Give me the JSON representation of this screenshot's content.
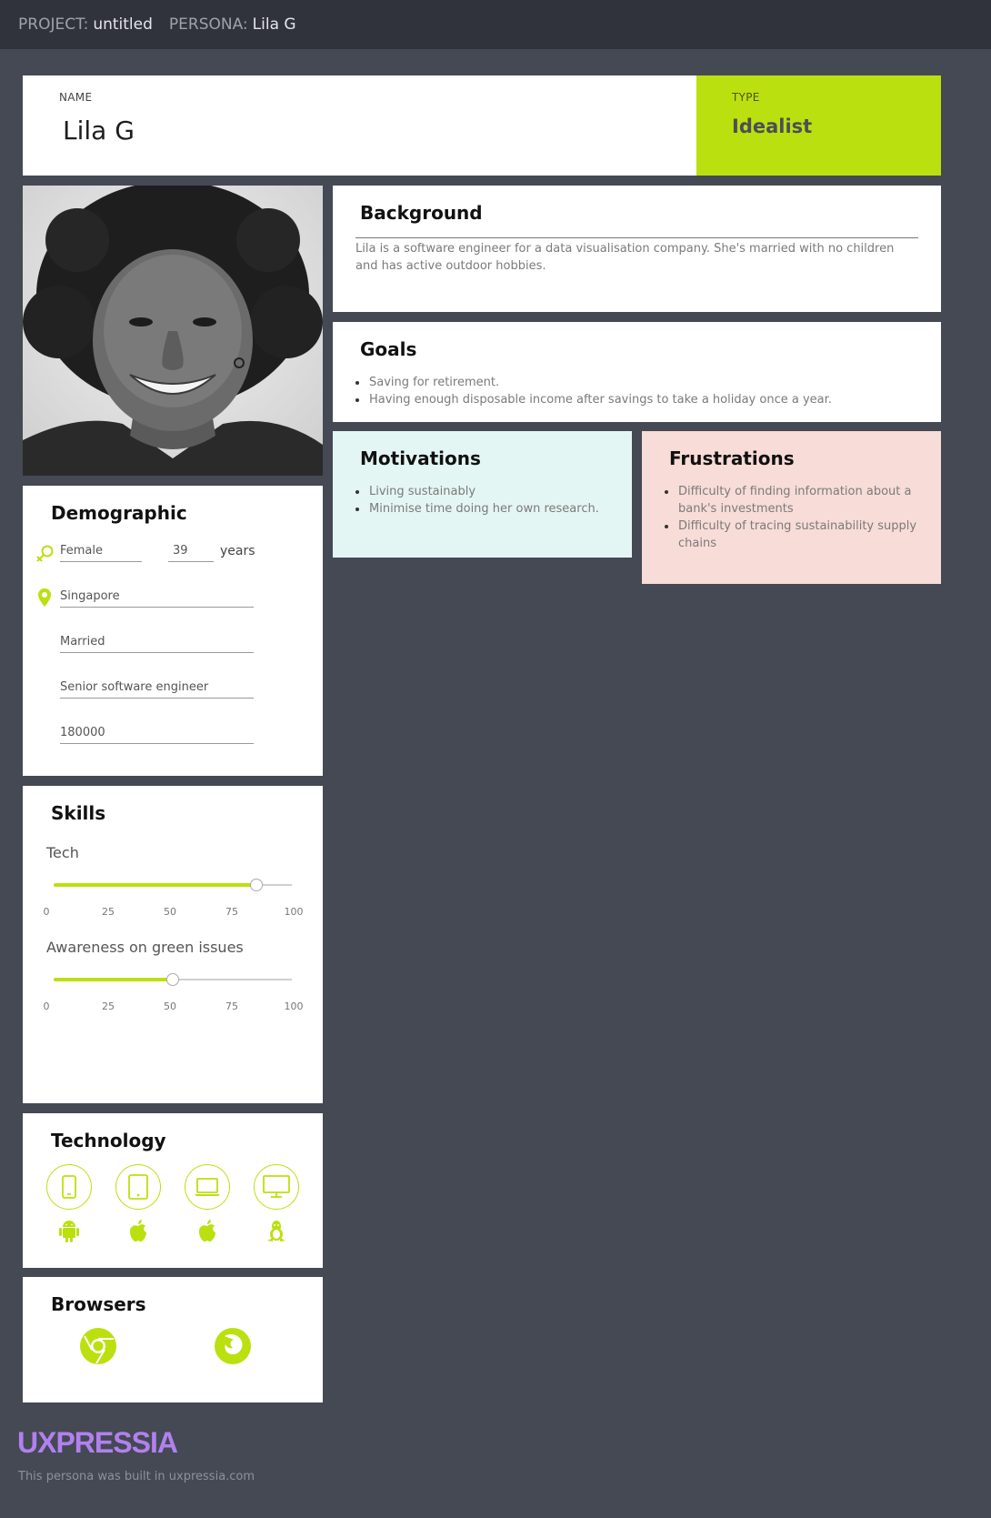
{
  "topbar": {
    "project_label": "PROJECT:",
    "project_value": "untitled",
    "persona_label": "PERSONA:",
    "persona_value": "Lila G"
  },
  "name": {
    "caption": "NAME",
    "value": "Lila G"
  },
  "type": {
    "caption": "TYPE",
    "value": "Idealist"
  },
  "background": {
    "title": "Background",
    "text": "Lila is a software engineer for a data visualisation company. She's married with no children and has active outdoor hobbies."
  },
  "goals": {
    "title": "Goals",
    "items": [
      "Saving for retirement.",
      "Having enough disposable income after savings to take a holiday once a year."
    ]
  },
  "motivations": {
    "title": "Motivations",
    "items": [
      "Living sustainably",
      "Minimise time doing her own research."
    ]
  },
  "frustrations": {
    "title": "Frustrations",
    "items": [
      "Difficulty of finding information about a bank's investments",
      "Difficulty of tracing sustainability supply chains"
    ]
  },
  "demographic": {
    "title": "Demographic",
    "gender": "Female",
    "age": "39",
    "age_unit": "years",
    "location": "Singapore",
    "status": "Married",
    "occupation": "Senior software engineer",
    "income": "180000"
  },
  "skills": {
    "title": "Skills",
    "ticks": [
      "0",
      "25",
      "50",
      "75",
      "100"
    ],
    "items": [
      {
        "name": "Tech",
        "value": 85
      },
      {
        "name": "Awareness on green issues",
        "value": 50
      }
    ]
  },
  "technology": {
    "title": "Technology",
    "devices": [
      "phone-icon",
      "tablet-icon",
      "laptop-icon",
      "desktop-icon"
    ],
    "os": [
      "android-icon",
      "apple-icon",
      "apple-icon",
      "linux-icon"
    ]
  },
  "browsers": {
    "title": "Browsers",
    "items": [
      "chrome-icon",
      "firefox-icon"
    ]
  },
  "footer": {
    "brand": "UXPRESSIA",
    "built": "This persona was built in uxpressia.com"
  },
  "colors": {
    "accent": "#bbe00f",
    "background": "#444954",
    "topbar": "#30333b",
    "motivations": "#e4f6f3",
    "frustrations": "#f8dcd7",
    "brand": "#b280ee"
  }
}
